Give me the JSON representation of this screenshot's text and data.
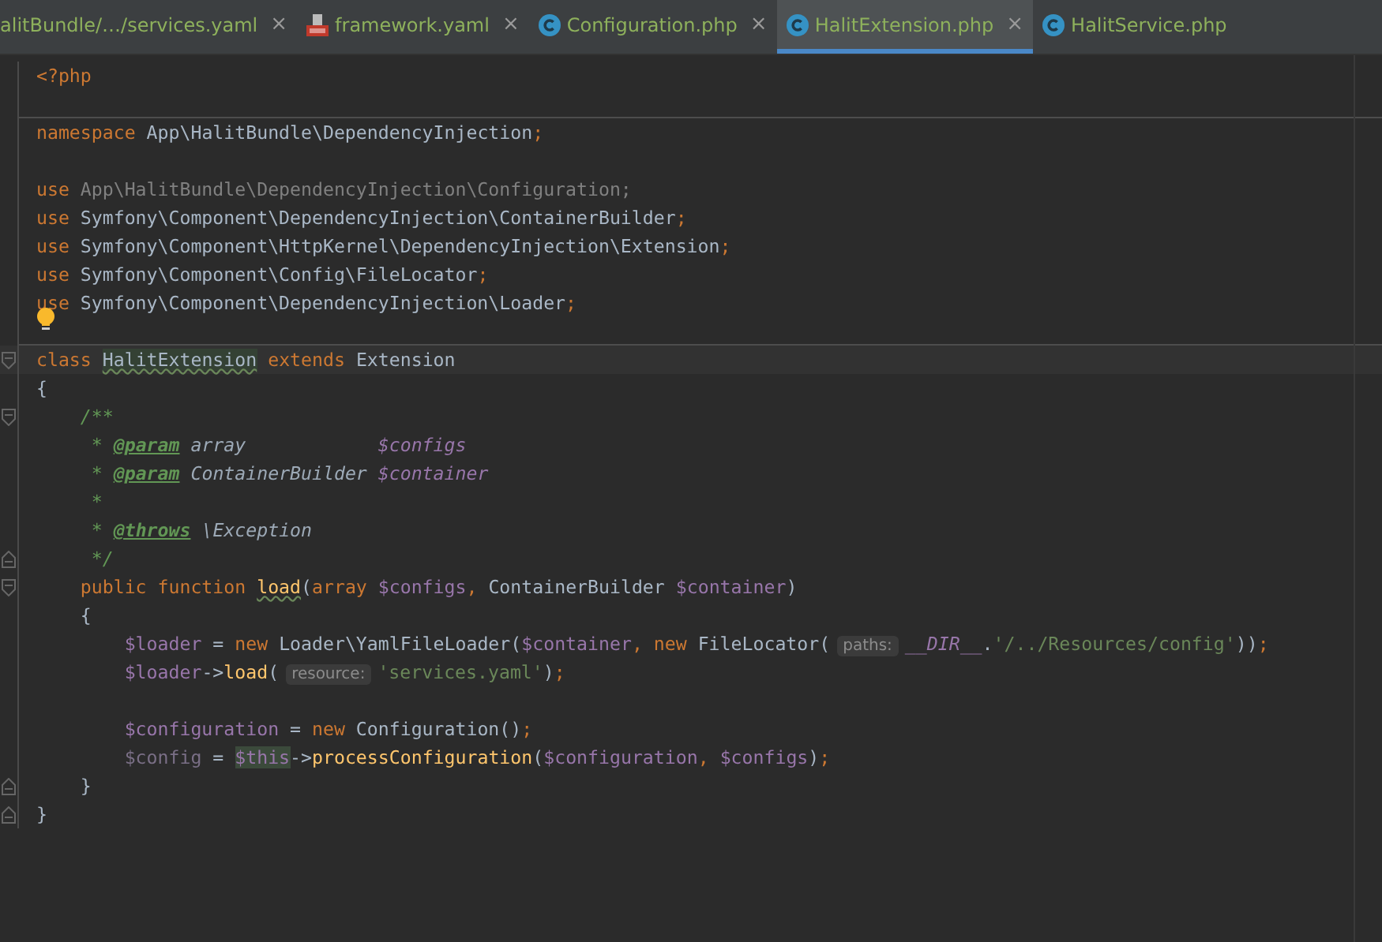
{
  "tabs": [
    {
      "label": "alitBundle/…/services.yaml",
      "kind": "plain",
      "selected": false,
      "close": "×"
    },
    {
      "label": "framework.yaml",
      "kind": "yaml",
      "selected": false,
      "close": "×"
    },
    {
      "label": "Configuration.php",
      "kind": "php",
      "selected": false,
      "close": "×"
    },
    {
      "label": "HalitExtension.php",
      "kind": "php",
      "selected": true,
      "close": "×"
    },
    {
      "label": "HalitService.php",
      "kind": "php",
      "selected": false
    }
  ],
  "editor": {
    "lines": [
      {
        "tokens": [
          {
            "kind": "kw",
            "text": "<?php"
          }
        ]
      },
      {
        "kind": "blank"
      },
      {
        "separator": true,
        "tokens": [
          {
            "kind": "kw",
            "text": "namespace "
          },
          {
            "kind": "text",
            "text": "App\\HalitBundle\\DependencyInjection"
          },
          {
            "kind": "kw",
            "text": ";"
          }
        ]
      },
      {
        "kind": "blank"
      },
      {
        "tokens": [
          {
            "kind": "kw",
            "text": "use "
          },
          {
            "kind": "unused",
            "text": "App\\HalitBundle\\DependencyInjection\\Configuration;"
          }
        ]
      },
      {
        "tokens": [
          {
            "kind": "kw",
            "text": "use "
          },
          {
            "kind": "text",
            "text": "Symfony\\Component\\DependencyInjection\\ContainerBuilder"
          },
          {
            "kind": "kw",
            "text": ";"
          }
        ]
      },
      {
        "tokens": [
          {
            "kind": "kw",
            "text": "use "
          },
          {
            "kind": "text",
            "text": "Symfony\\Component\\HttpKernel\\DependencyInjection\\Extension"
          },
          {
            "kind": "kw",
            "text": ";"
          }
        ]
      },
      {
        "tokens": [
          {
            "kind": "kw",
            "text": "use "
          },
          {
            "kind": "text",
            "text": "Symfony\\Component\\Config\\FileLocator"
          },
          {
            "kind": "kw",
            "text": ";"
          }
        ]
      },
      {
        "tokens": [
          {
            "kind": "kw",
            "text": "use "
          },
          {
            "kind": "text",
            "text": "Symfony\\Component\\DependencyInjection\\Loader"
          },
          {
            "kind": "kw",
            "text": ";"
          }
        ]
      },
      {
        "kind": "intention"
      },
      {
        "separator": true,
        "caret": true,
        "kind": "opener",
        "tokens": [
          {
            "kind": "kw",
            "text": "class "
          },
          {
            "kind": "decl",
            "text": "HalitExtension"
          },
          {
            "kind": "kw",
            "text": " extends "
          },
          {
            "kind": "text",
            "text": "Extension"
          }
        ]
      },
      {
        "tokens": [
          {
            "kind": "text",
            "text": "{"
          }
        ]
      },
      {
        "kind": "opener",
        "tokens": [
          {
            "kind": "doc",
            "text": "    /**"
          }
        ]
      },
      {
        "tokens": [
          {
            "kind": "doc",
            "text": "     * "
          },
          {
            "kind": "doctag",
            "text": "@param"
          },
          {
            "kind": "docitalic",
            "text": " array            "
          },
          {
            "kind": "docvar",
            "text": "$configs"
          }
        ]
      },
      {
        "tokens": [
          {
            "kind": "doc",
            "text": "     * "
          },
          {
            "kind": "doctag",
            "text": "@param"
          },
          {
            "kind": "docitalic",
            "text": " ContainerBuilder "
          },
          {
            "kind": "docvar",
            "text": "$container"
          }
        ]
      },
      {
        "tokens": [
          {
            "kind": "doc",
            "text": "     *"
          }
        ]
      },
      {
        "tokens": [
          {
            "kind": "doc",
            "text": "     * "
          },
          {
            "kind": "doctag",
            "text": "@throws"
          },
          {
            "kind": "docitalic",
            "text": " \\Exception"
          }
        ]
      },
      {
        "kind": "closer",
        "tokens": [
          {
            "kind": "doc",
            "text": "     */"
          }
        ]
      },
      {
        "kind": "opener",
        "tokens": [
          {
            "kind": "kw",
            "text": "    public function "
          },
          {
            "kind": "fn",
            "text": "load"
          },
          {
            "kind": "text",
            "text": "("
          },
          {
            "kind": "kw",
            "text": "array "
          },
          {
            "kind": "var",
            "text": "$configs"
          },
          {
            "kind": "kw",
            "text": ", "
          },
          {
            "kind": "text",
            "text": "ContainerBuilder "
          },
          {
            "kind": "var",
            "text": "$container"
          },
          {
            "kind": "text",
            "text": ")"
          }
        ]
      },
      {
        "tokens": [
          {
            "kind": "text",
            "text": "    {"
          }
        ]
      },
      {
        "tokens": [
          {
            "kind": "var",
            "text": "        $loader "
          },
          {
            "kind": "text",
            "text": "= "
          },
          {
            "kind": "kw",
            "text": "new "
          },
          {
            "kind": "text",
            "text": "Loader\\YamlFileLoader("
          },
          {
            "kind": "var",
            "text": "$container"
          },
          {
            "kind": "kw",
            "text": ", new "
          },
          {
            "kind": "text",
            "text": "FileLocator("
          },
          {
            "kind": "hint",
            "text": "paths:"
          },
          {
            "kind": "const",
            "text": "__DIR__"
          },
          {
            "kind": "text",
            "text": "."
          },
          {
            "kind": "str",
            "text": "'/../Resources/config'"
          },
          {
            "kind": "text",
            "text": "))"
          },
          {
            "kind": "kw",
            "text": ";"
          }
        ]
      },
      {
        "tokens": [
          {
            "kind": "var",
            "text": "        $loader"
          },
          {
            "kind": "text",
            "text": "->"
          },
          {
            "kind": "call",
            "text": "load"
          },
          {
            "kind": "text",
            "text": "("
          },
          {
            "kind": "hint",
            "text": "resource:"
          },
          {
            "kind": "str",
            "text": "'services.yaml'"
          },
          {
            "kind": "text",
            "text": ")"
          },
          {
            "kind": "kw",
            "text": ";"
          }
        ]
      },
      {
        "kind": "blank"
      },
      {
        "tokens": [
          {
            "kind": "var",
            "text": "        $configuration "
          },
          {
            "kind": "text",
            "text": "= "
          },
          {
            "kind": "kw",
            "text": "new "
          },
          {
            "kind": "text",
            "text": "Configuration()"
          },
          {
            "kind": "kw",
            "text": ";"
          }
        ]
      },
      {
        "tokens": [
          {
            "kind": "unusedvar",
            "text": "        $config "
          },
          {
            "kind": "text",
            "text": "= "
          },
          {
            "kind": "this",
            "text": "$this"
          },
          {
            "kind": "text",
            "text": "->"
          },
          {
            "kind": "call",
            "text": "processConfiguration"
          },
          {
            "kind": "text",
            "text": "("
          },
          {
            "kind": "var",
            "text": "$configuration"
          },
          {
            "kind": "kw",
            "text": ", "
          },
          {
            "kind": "var",
            "text": "$configs"
          },
          {
            "kind": "text",
            "text": ")"
          },
          {
            "kind": "kw",
            "text": ";"
          }
        ]
      },
      {
        "kind": "closer",
        "tokens": [
          {
            "kind": "text",
            "text": "    }"
          }
        ]
      },
      {
        "kind": "closer",
        "tokens": [
          {
            "kind": "text",
            "text": "}"
          }
        ]
      }
    ]
  }
}
